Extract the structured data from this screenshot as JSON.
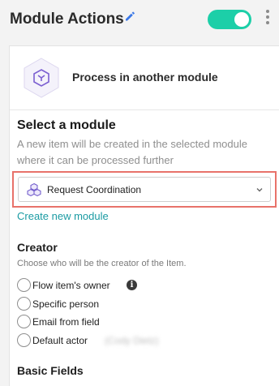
{
  "header": {
    "title": "Module Actions",
    "toggle_on": true,
    "accent_color": "#1ccfa8"
  },
  "panel": {
    "title": "Process in another module",
    "icon": "module-hexagon-icon"
  },
  "select_section": {
    "title": "Select a module",
    "description": "A new item will be created in the selected module where it can be processed further",
    "selected_value": "Request Coordination",
    "create_link": "Create new module",
    "highlight_color": "#e8726a"
  },
  "creator": {
    "title": "Creator",
    "description": "Choose who will be the creator of the Item.",
    "options": [
      "Flow item's owner",
      "Specific person",
      "Email from field",
      "Default actor"
    ],
    "default_actor_name": "(Cody Dietz)"
  },
  "basic_fields": {
    "title": "Basic Fields"
  }
}
